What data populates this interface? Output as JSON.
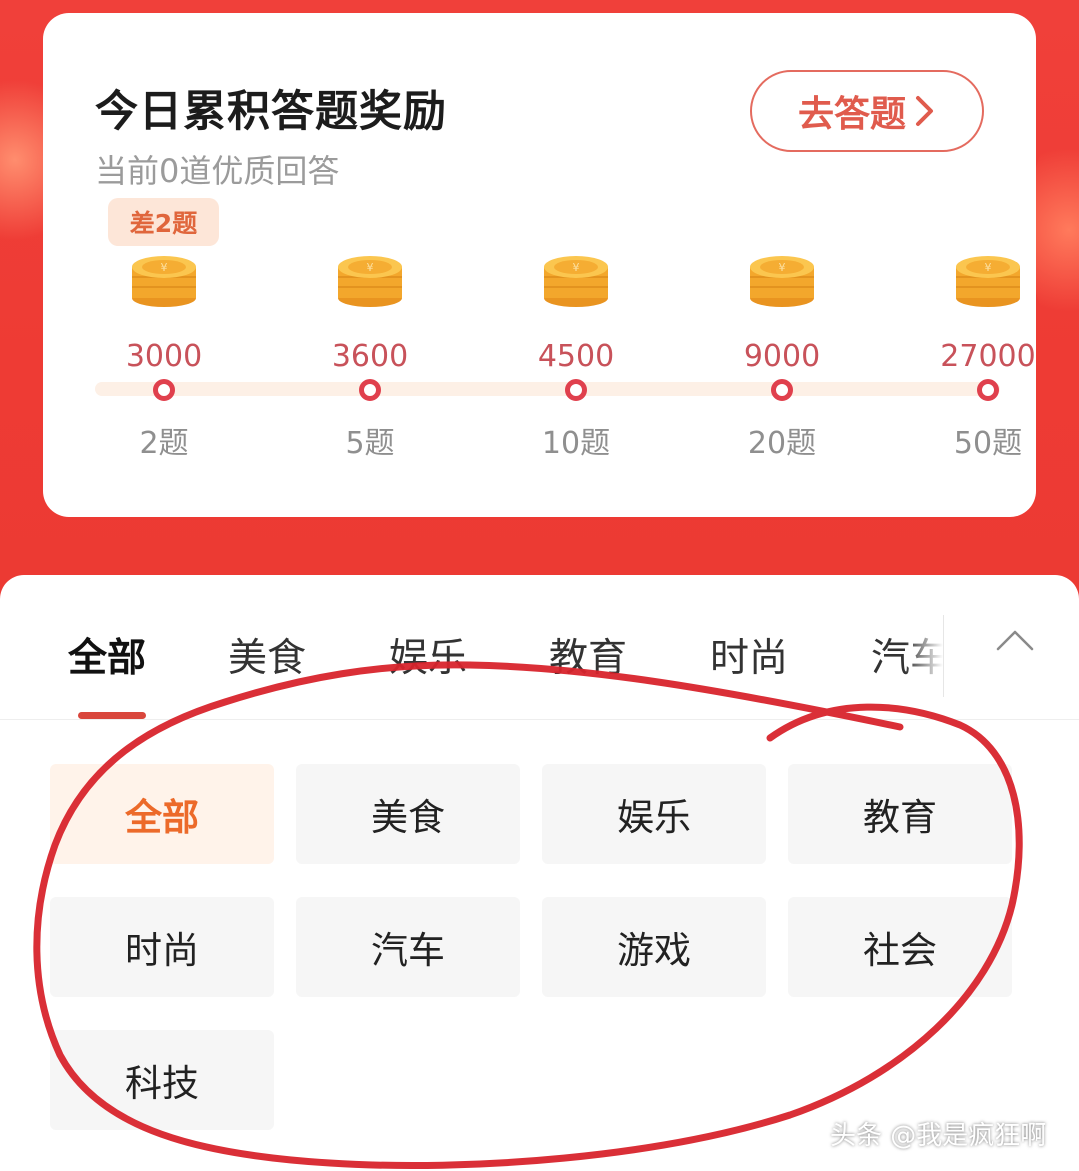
{
  "reward_card": {
    "title": "今日累积答题奖励",
    "subtitle": "当前0道优质回答",
    "go_button_label": "去答题",
    "remaining_badge": "差2题",
    "progress_answered": 0,
    "milestones": [
      {
        "coins": "3000",
        "questions": "2题"
      },
      {
        "coins": "3600",
        "questions": "5题"
      },
      {
        "coins": "4500",
        "questions": "10题"
      },
      {
        "coins": "9000",
        "questions": "20题"
      },
      {
        "coins": "27000",
        "questions": "50题"
      }
    ]
  },
  "tabs": {
    "items": [
      "全部",
      "美食",
      "娱乐",
      "教育",
      "时尚",
      "汽车"
    ],
    "active": "全部"
  },
  "categories": {
    "items": [
      "全部",
      "美食",
      "娱乐",
      "教育",
      "时尚",
      "汽车",
      "游戏",
      "社会",
      "科技"
    ],
    "selected": "全部"
  },
  "colors": {
    "accent_red": "#d9463c",
    "selected_orange": "#ec6a2a",
    "coin_gold": "#f7b53a",
    "annotation_red": "#d8242c"
  },
  "watermark": "头条 @我是疯狂啊"
}
